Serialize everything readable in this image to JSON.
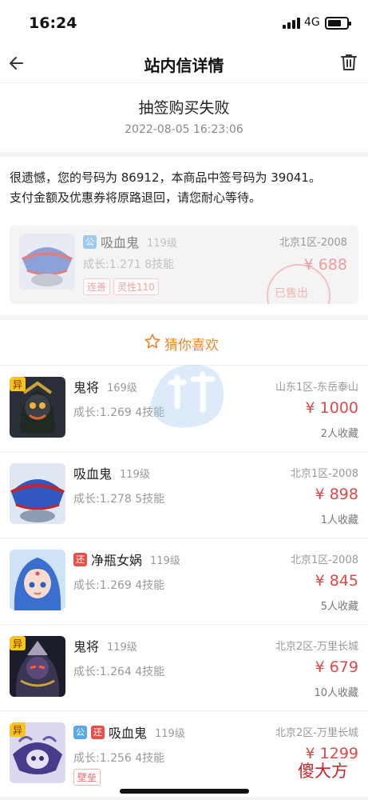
{
  "status_bar": {
    "time": "16:24",
    "network": "4G"
  },
  "nav": {
    "title": "站内信详情",
    "back_icon": "arrow-left-icon",
    "delete_icon": "trash-icon"
  },
  "message": {
    "subject": "抽签购买失败",
    "date": "2022-08-05 16:23:06",
    "body_line1": "很遗憾，您的号码为 86912，本商品中签号码为 39041。",
    "body_line2": "支付金额及优惠券将原路退回，请您耐心等待。"
  },
  "card": {
    "badge": "公",
    "name": "吸血鬼",
    "level": "119级",
    "growth": "成长:1.271 8技能",
    "tags": [
      "连善",
      "灵性110"
    ],
    "region": "北京1区-2008",
    "price": "¥ 688",
    "stamp": "已售出"
  },
  "recommend": {
    "title": "猜你喜欢"
  },
  "items": [
    {
      "badges": [
        {
          "text": "异",
          "color": "gold"
        }
      ],
      "flags": [],
      "name": "鬼将",
      "level": "169级",
      "growth": "成长:1.269 4技能",
      "region": "山东1区-东岳泰山",
      "price": "¥ 1000",
      "fav": "2人收藏",
      "tags": []
    },
    {
      "badges": [],
      "flags": [],
      "name": "吸血鬼",
      "level": "119级",
      "growth": "成长:1.278 5技能",
      "region": "北京1区-2008",
      "price": "¥ 898",
      "fav": "1人收藏",
      "tags": []
    },
    {
      "badges": [],
      "flags": [
        {
          "text": "还",
          "color": "red"
        }
      ],
      "name": "净瓶女娲",
      "level": "119级",
      "growth": "成长:1.269 4技能",
      "region": "北京1区-2008",
      "price": "¥ 845",
      "fav": "5人收藏",
      "tags": []
    },
    {
      "badges": [
        {
          "text": "异",
          "color": "gold"
        }
      ],
      "flags": [],
      "name": "鬼将",
      "level": "119级",
      "growth": "成长:1.264 4技能",
      "region": "北京2区-万里长城",
      "price": "¥ 679",
      "fav": "10人收藏",
      "tags": []
    },
    {
      "badges": [
        {
          "text": "异",
          "color": "gold"
        }
      ],
      "flags": [
        {
          "text": "公",
          "color": "blue"
        },
        {
          "text": "还",
          "color": "red"
        }
      ],
      "name": "吸血鬼",
      "level": "119级",
      "growth": "成长:1.256 4技能",
      "region": "北京2区-万里长城",
      "price": "¥ 1299",
      "fav": "",
      "tags": [
        "壁垒"
      ]
    }
  ],
  "brand_mark": "傻大方"
}
